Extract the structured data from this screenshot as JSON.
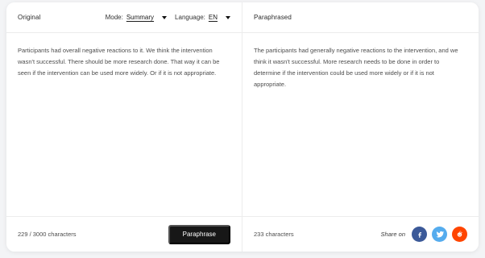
{
  "left_pane": {
    "title": "Original",
    "mode_label": "Mode:",
    "mode_value": "Summary",
    "language_label": "Language:",
    "language_value": "EN",
    "text": "Participants had overall negative reactions to it. We think the intervention wasn't successful. There should be more research done. That way it can be seen if the intervention can be used more widely. Or if it is not appropriate.",
    "char_count": "229 / 3000 characters",
    "action_label": "Paraphrase"
  },
  "right_pane": {
    "title": "Paraphrased",
    "text": "The participants had generally negative reactions to the intervention, and we think it wasn't successful. More research needs to be done in order to determine if the intervention could be used more widely or if it is not appropriate.",
    "char_count": "233 characters",
    "share_label": "Share on",
    "share": [
      {
        "network": "facebook",
        "icon": "facebook-icon",
        "color": "#3b5998"
      },
      {
        "network": "twitter",
        "icon": "twitter-icon",
        "color": "#55acee"
      },
      {
        "network": "reddit",
        "icon": "reddit-icon",
        "color": "#ff4500"
      }
    ]
  },
  "colors": {
    "page_bg": "#f3f4f6",
    "card_bg": "#ffffff",
    "divider": "#ececec",
    "primary_button_bg": "#171717",
    "text_main": "#2b2b2b",
    "text_body": "#4d4d4d"
  }
}
